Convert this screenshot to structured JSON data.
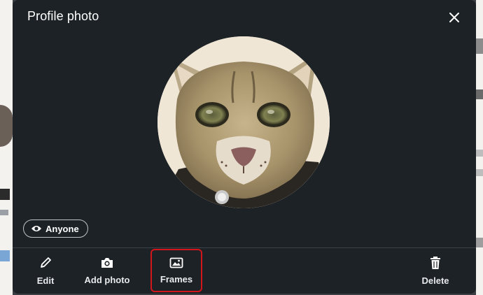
{
  "dialog": {
    "title": "Profile photo",
    "close_icon": "close-icon"
  },
  "photo": {
    "alt": "Profile photo of a caracal cat"
  },
  "visibility": {
    "label": "Anyone",
    "icon": "eye-icon"
  },
  "actions": [
    {
      "label": "Edit",
      "icon": "pencil-icon"
    },
    {
      "label": "Add photo",
      "icon": "camera-icon"
    },
    {
      "label": "Frames",
      "icon": "image-icon",
      "highlighted": true
    },
    {
      "label": "Delete",
      "icon": "trash-icon"
    }
  ],
  "colors": {
    "modal_bg": "#1d2226",
    "highlight": "#d2161c",
    "text": "#ffffff"
  }
}
